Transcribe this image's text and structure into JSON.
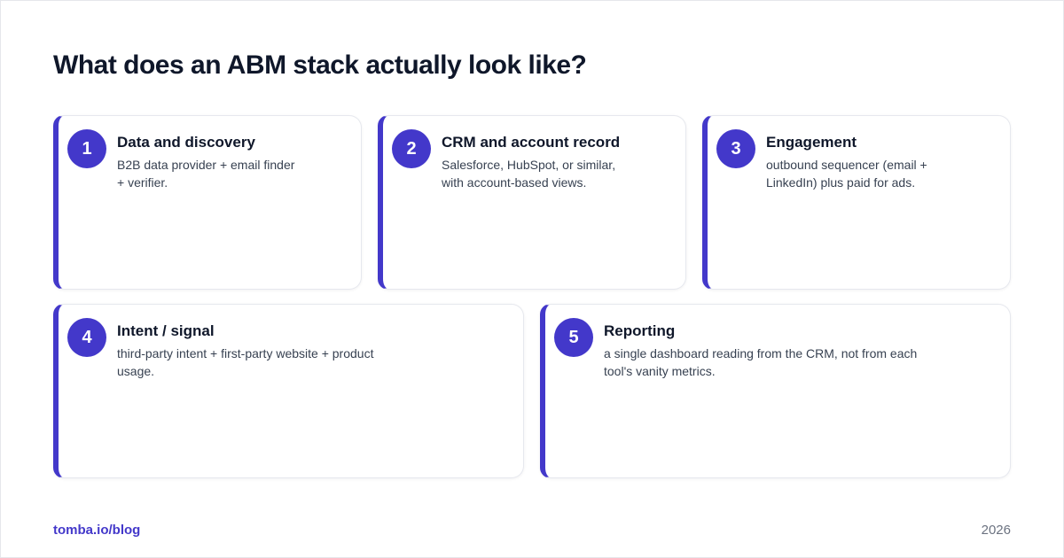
{
  "title": "What does an ABM stack actually look like?",
  "accent_color": "#4338ca",
  "cards": [
    {
      "number": "1",
      "title": "Data and discovery",
      "desc_lines": [
        "B2B data provider + email finder",
        "+ verifier."
      ]
    },
    {
      "number": "2",
      "title": "CRM and account record",
      "desc_lines": [
        "Salesforce, HubSpot, or similar,",
        "with account-based views."
      ]
    },
    {
      "number": "3",
      "title": "Engagement",
      "desc_lines": [
        "outbound sequencer (email +",
        "LinkedIn) plus paid for ads."
      ]
    },
    {
      "number": "4",
      "title": "Intent / signal",
      "desc_lines": [
        "third-party intent + first-party website + product",
        "usage."
      ]
    },
    {
      "number": "5",
      "title": "Reporting",
      "desc_lines": [
        "a single dashboard reading from the CRM, not from each",
        "tool's vanity metrics."
      ]
    }
  ],
  "footer": {
    "link": "tomba.io/blog",
    "year": "2026"
  }
}
